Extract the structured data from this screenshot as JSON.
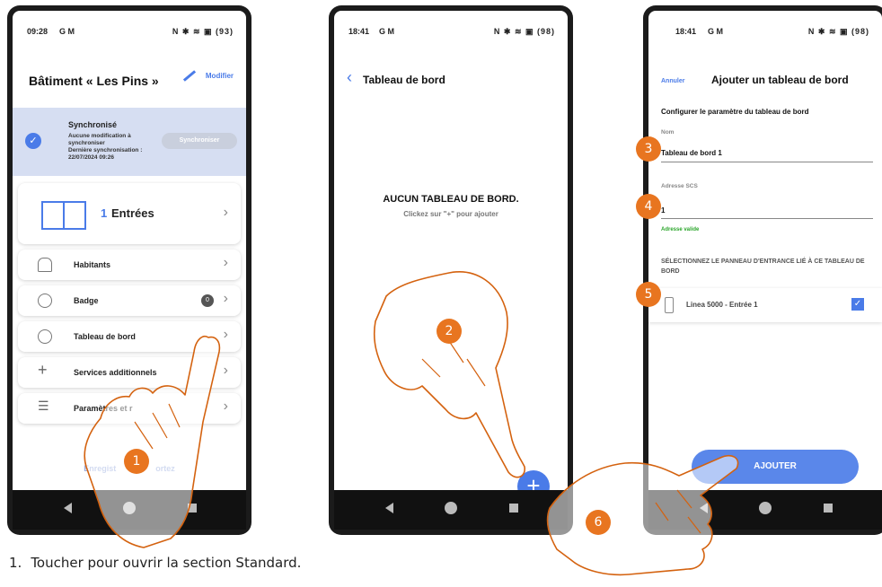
{
  "colors": {
    "accent": "#4a7be8",
    "marker": "#e87520",
    "valid": "#2aa52a"
  },
  "phone1": {
    "status_time": "09:28",
    "status_left_icons": "G M",
    "status_right_icons": "N ✱ ≋ ▣ (93)",
    "title": "Bâtiment « Les Pins »",
    "edit_label": "Modifier",
    "sync": {
      "title": "Synchronisé",
      "line1": "Aucune modification à",
      "line2": "synchroniser",
      "line3": "Dernière synchronisation :",
      "line4": "22/07/2024 09:26",
      "button": "Synchroniser"
    },
    "entrees_count": "1",
    "entrees_label": "Entrées",
    "rows": [
      {
        "label": "Habitants",
        "icon": "person-icon"
      },
      {
        "label": "Badge",
        "icon": "badge-icon",
        "count": "0"
      },
      {
        "label": "Tableau de bord",
        "icon": "dashboard-icon"
      },
      {
        "label": "Services additionnels",
        "icon": "plus-icon"
      },
      {
        "label": "Paramètres et r",
        "icon": "settings-icon"
      }
    ],
    "save_link": "Enregist",
    "save_link_tail": "ortez"
  },
  "phone2": {
    "status_time": "18:41",
    "status_left_icons": "G M",
    "status_right_icons": "N ✱ ≋ ▣ (98)",
    "title": "Tableau de bord",
    "empty_title": "AUCUN TABLEAU DE BORD.",
    "empty_hint": "Clickez sur \"+\" pour ajouter",
    "fab": "+"
  },
  "phone3": {
    "status_time": "18:41",
    "status_left_icons": "G M",
    "status_right_icons": "N ✱ ≋ ▣ (98)",
    "cancel": "Annuler",
    "title": "Ajouter un tableau de bord",
    "subtitle": "Configurer le paramètre du tableau de bord",
    "name_label": "Nom",
    "name_value": "Tableau de bord 1",
    "address_label": "Adresse SCS",
    "address_value": "1",
    "address_valid": "Adresse valide",
    "section": "SÉLECTIONNEZ LE PANNEAU D'ENTRANCE LIÉ À CE TABLEAU DE BORD",
    "panel_label": "Linea 5000 - Entrée 1",
    "panel_check": "✓",
    "add_button": "AJOUTER"
  },
  "markers": [
    "1",
    "2",
    "3",
    "4",
    "5",
    "6"
  ],
  "caption": {
    "num": "1.",
    "text": "Toucher pour ouvrir la section Standard."
  }
}
